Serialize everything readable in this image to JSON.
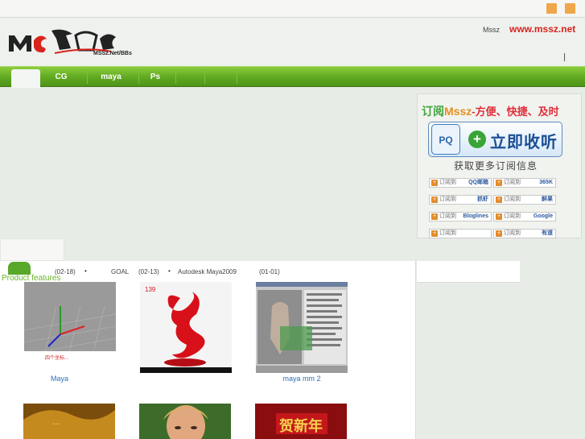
{
  "header": {
    "logo_text": "MSSz.Net/BBs",
    "site_label": "Mssz",
    "site_url": "www.mssz.net"
  },
  "nav": {
    "tabs": [
      {
        "label": ""
      },
      {
        "label": "CG"
      },
      {
        "label": "maya"
      },
      {
        "label": "Ps"
      },
      {
        "label": ""
      },
      {
        "label": ""
      }
    ]
  },
  "subscribe": {
    "title_prefix": "订阅",
    "brand": "Mssz",
    "title_suffix": "-方便、快捷、及时",
    "pq_text": "PQ",
    "listen_label": "立即收听",
    "more_text": "获取更多订阅信息",
    "chip_prefix": "订阅到",
    "services": [
      "QQ邮箱",
      "365K",
      "抓虾",
      "鲜果",
      "Bloglines",
      "Google",
      "",
      "有道"
    ]
  },
  "content": {
    "section_label": "Product features",
    "ticker": [
      "(02-18)",
      "•",
      "GOAL",
      "(02-13)",
      "•",
      "Autodesk Maya2009",
      "(01-01)"
    ],
    "products": [
      {
        "caption": "Maya",
        "overlay_text": "四个坐标..."
      },
      {
        "caption": "",
        "overlay_text": "139"
      },
      {
        "caption": "maya   mm    2",
        "overlay_text": ""
      },
      {
        "caption": "",
        "overlay_text": ""
      },
      {
        "caption": "",
        "overlay_text": ""
      },
      {
        "caption": "",
        "overlay_text": "贺新年"
      }
    ]
  },
  "colors": {
    "nav_green": "#5fa821",
    "url_red": "#d9231d",
    "accent_orange": "#f0a64a",
    "link_blue": "#2c6fb3"
  }
}
